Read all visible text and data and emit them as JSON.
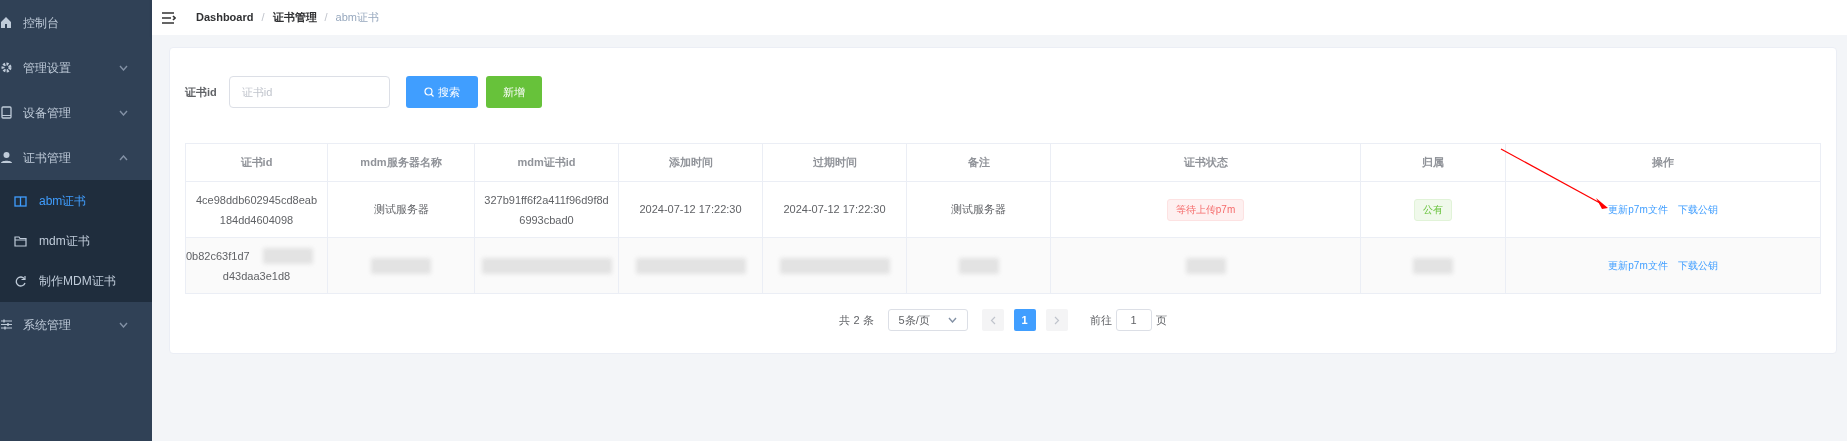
{
  "sidebar": {
    "items": [
      {
        "label": "控制台"
      },
      {
        "label": "管理设置",
        "expanded": false
      },
      {
        "label": "设备管理",
        "expanded": false
      },
      {
        "label": "证书管理",
        "expanded": true,
        "children": [
          {
            "label": "abm证书",
            "selected": true
          },
          {
            "label": "mdm证书",
            "selected": false
          },
          {
            "label": "制作MDM证书",
            "selected": false
          }
        ]
      },
      {
        "label": "系统管理",
        "expanded": false
      }
    ]
  },
  "breadcrumb": {
    "items": [
      "Dashboard",
      "证书管理",
      "abm证书"
    ],
    "separators": [
      "/",
      "/"
    ]
  },
  "search": {
    "label": "证书id",
    "placeholder": "证书id",
    "search_button": "搜索",
    "add_button": "新增"
  },
  "table": {
    "columns": [
      "证书id",
      "mdm服务器名称",
      "mdm证书id",
      "添加时间",
      "过期时间",
      "备注",
      "证书状态",
      "归属",
      "操作"
    ],
    "rows": [
      {
        "redacted": false,
        "id": [
          "4ce98ddb602945cd8eab",
          "184dd4604098"
        ],
        "server": "测试服务器",
        "mdm_id": [
          "327b91ff6f2a411f96d9f8d",
          "6993cbad0"
        ],
        "added": "2024-07-12 17:22:30",
        "expires": "2024-07-12 17:22:30",
        "note": "测试服务器",
        "status": "等待上传p7m",
        "owner": "公有",
        "actions": [
          "更新p7m文件",
          "下载公钥"
        ]
      },
      {
        "redacted": true,
        "id": [
          "0b82c63f1d7",
          "d43daa3e1d8"
        ],
        "actions": [
          "更新p7m文件",
          "下载公钥"
        ]
      }
    ]
  },
  "pagination": {
    "total": "共 2 条",
    "page_size": "5条/页",
    "pages": [
      {
        "label": "1",
        "selected": true
      }
    ],
    "goto_label": "前往",
    "goto_value": "1",
    "goto_suffix": "页"
  }
}
